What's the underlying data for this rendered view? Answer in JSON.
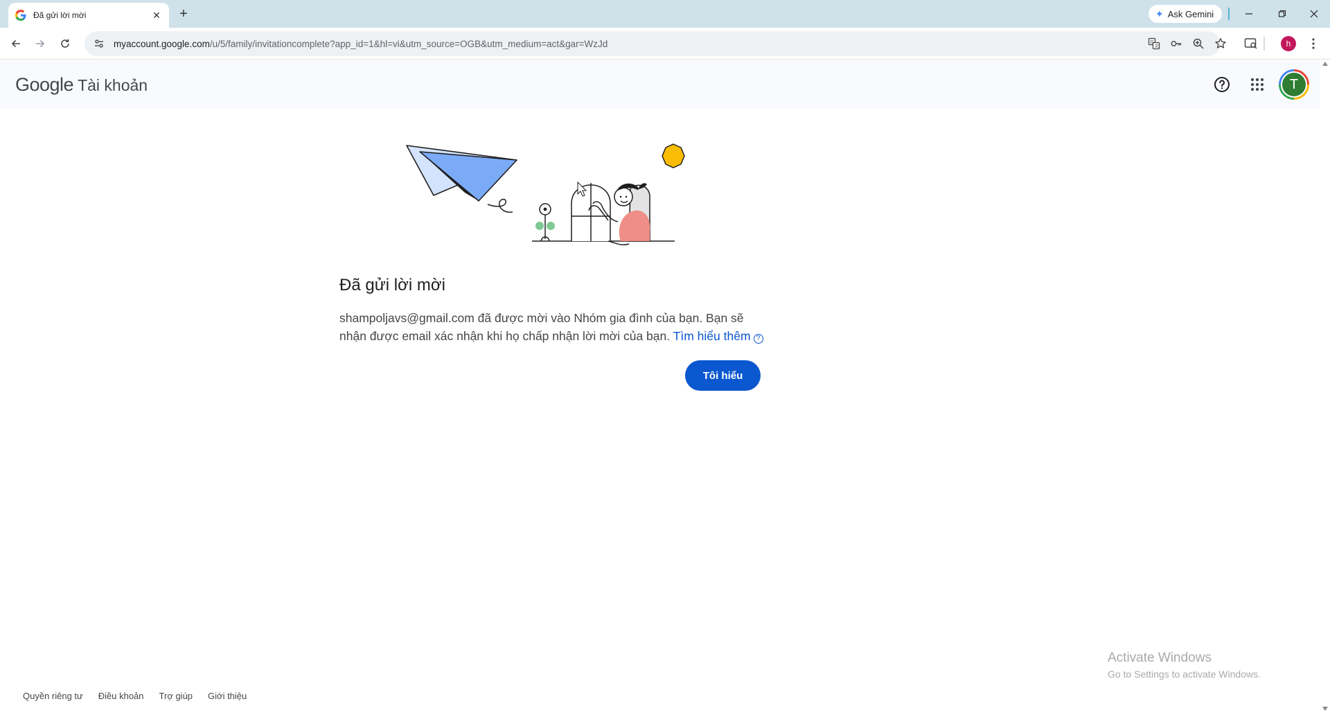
{
  "browser": {
    "tab_title": "Đã gửi lời mời",
    "tab_close": "✕",
    "new_tab": "+",
    "ask_gemini": "Ask Gemini",
    "url_host": "myaccount.google.com",
    "url_path": "/u/5/family/invitationcomplete?app_id=1&hl=vi&utm_source=OGB&utm_medium=act&gar=WzJd",
    "profile_initial": "h"
  },
  "header": {
    "brand": "Google",
    "product": "Tài khoản",
    "avatar_initial": "T"
  },
  "main": {
    "title": "Đã gửi lời mời",
    "message_line": "shampoljavs@gmail.com đã được mời vào Nhóm gia đình của bạn. Bạn sẽ nhận được email xác nhận khi họ chấp nhận lời mời của bạn.",
    "learn_more": "Tìm hiểu thêm",
    "help_glyph": "?",
    "ok_button": "Tôi hiểu"
  },
  "footer": {
    "links": [
      "Quyền riêng tư",
      "Điều khoản",
      "Trợ giúp",
      "Giới thiệu"
    ]
  },
  "watermark": {
    "line1": "Activate Windows",
    "line2": "Go to Settings to activate Windows."
  },
  "colors": {
    "primary": "#0b57d0",
    "avatar_bg": "#2e7d32",
    "illustration_yellow": "#fbbc04",
    "illustration_pink": "#ee8e87",
    "illustration_blue": "#a8c7fa"
  }
}
